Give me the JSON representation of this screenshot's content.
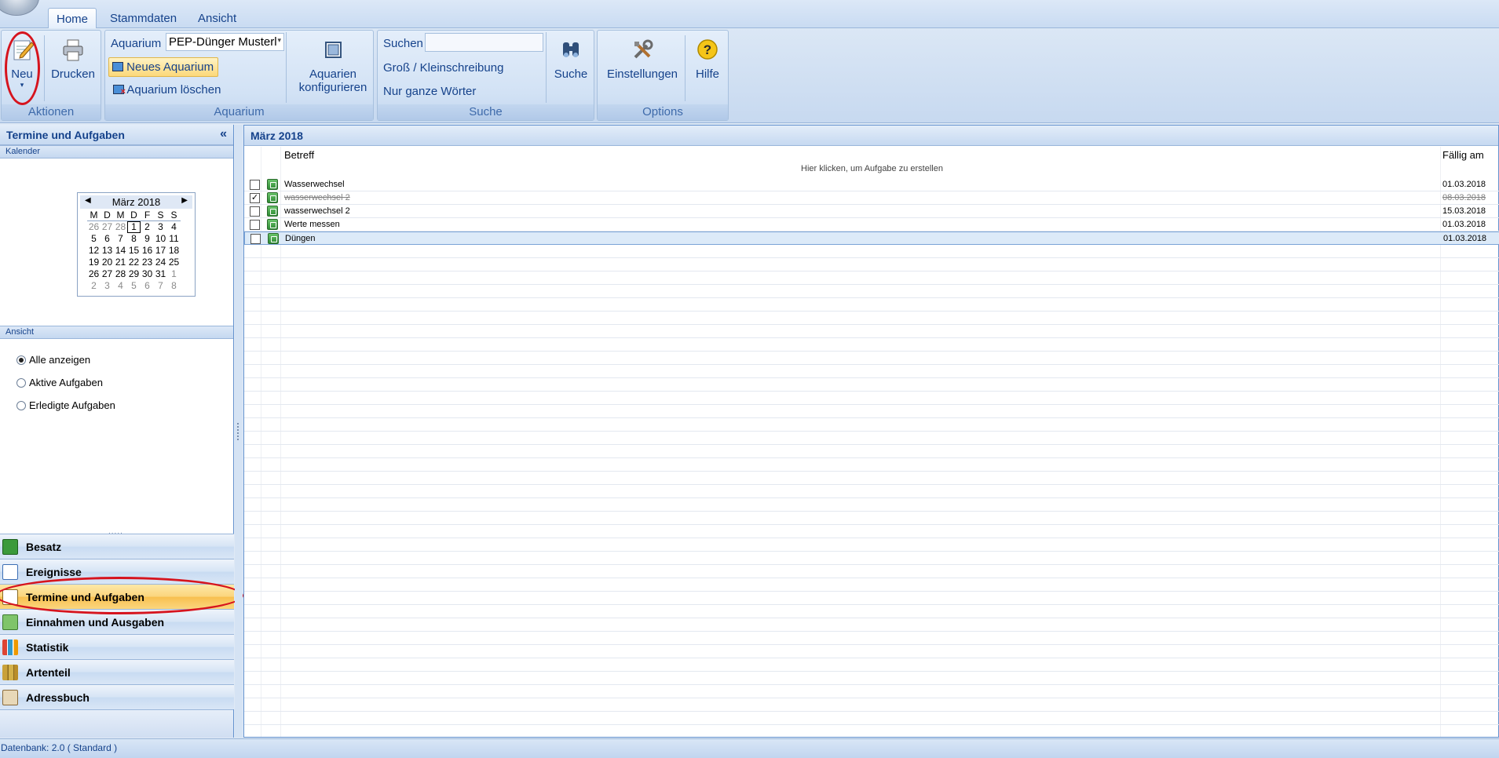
{
  "ribbon": {
    "tabs": [
      "Home",
      "Stammdaten",
      "Ansicht"
    ],
    "groups": {
      "aktionen": {
        "label": "Aktionen",
        "neu": "Neu",
        "drucken": "Drucken"
      },
      "aquarium": {
        "label": "Aquarium",
        "field_label": "Aquarium",
        "field_value": "PEP-Dünger Musterl",
        "neues": "Neues Aquarium",
        "loeschen": "Aquarium löschen",
        "konfig_1": "Aquarien",
        "konfig_2": "konfigurieren"
      },
      "suche": {
        "label": "Suche",
        "suchen": "Suchen",
        "search_value": "",
        "gross_klein": "Groß / Kleinschreibung",
        "ganze_woerter": "Nur ganze Wörter",
        "suche_btn": "Suche"
      },
      "options": {
        "label": "Options",
        "einstellungen": "Einstellungen",
        "hilfe": "Hilfe"
      }
    }
  },
  "left": {
    "title": "Termine und Aufgaben",
    "collapse": "«",
    "kalender_title": "Kalender",
    "calendar": {
      "month": "März 2018",
      "day_names": [
        "M",
        "D",
        "M",
        "D",
        "F",
        "S",
        "S"
      ],
      "weeks": [
        [
          "26",
          "27",
          "28",
          "1",
          "2",
          "3",
          "4"
        ],
        [
          "5",
          "6",
          "7",
          "8",
          "9",
          "10",
          "11"
        ],
        [
          "12",
          "13",
          "14",
          "15",
          "16",
          "17",
          "18"
        ],
        [
          "19",
          "20",
          "21",
          "22",
          "23",
          "24",
          "25"
        ],
        [
          "26",
          "27",
          "28",
          "29",
          "30",
          "31",
          "1"
        ],
        [
          "2",
          "3",
          "4",
          "5",
          "6",
          "7",
          "8"
        ]
      ],
      "today": "1"
    },
    "ansicht_title": "Ansicht",
    "filters": [
      "Alle anzeigen",
      "Aktive Aufgaben",
      "Erledigte Aufgaben"
    ],
    "grip": ".....",
    "nav": [
      "Besatz",
      "Ereignisse",
      "Termine und Aufgaben",
      "Einnahmen und Ausgaben",
      "Statistik",
      "Artenteil",
      "Adressbuch"
    ]
  },
  "main": {
    "title": "März 2018",
    "col_subject": "Betreff",
    "col_due": "Fällig am",
    "add_hint": "Hier klicken, um Aufgabe zu erstellen",
    "tasks": [
      {
        "subject": "Wasserwechsel",
        "due": "01.03.2018",
        "done": false
      },
      {
        "subject": "wasserwechsel 2",
        "due": "08.03.2018",
        "done": true
      },
      {
        "subject": "wasserwechsel 2",
        "due": "15.03.2018",
        "done": false
      },
      {
        "subject": "Werte messen",
        "due": "01.03.2018",
        "done": false
      },
      {
        "subject": "Düngen",
        "due": "01.03.2018",
        "done": false
      }
    ]
  },
  "status": "Datenbank: 2.0 ( Standard )",
  "colors": {
    "highlight_red": "#d6141e",
    "active_nav": "#fbd57c",
    "ribbon": "#c7d9f0"
  }
}
